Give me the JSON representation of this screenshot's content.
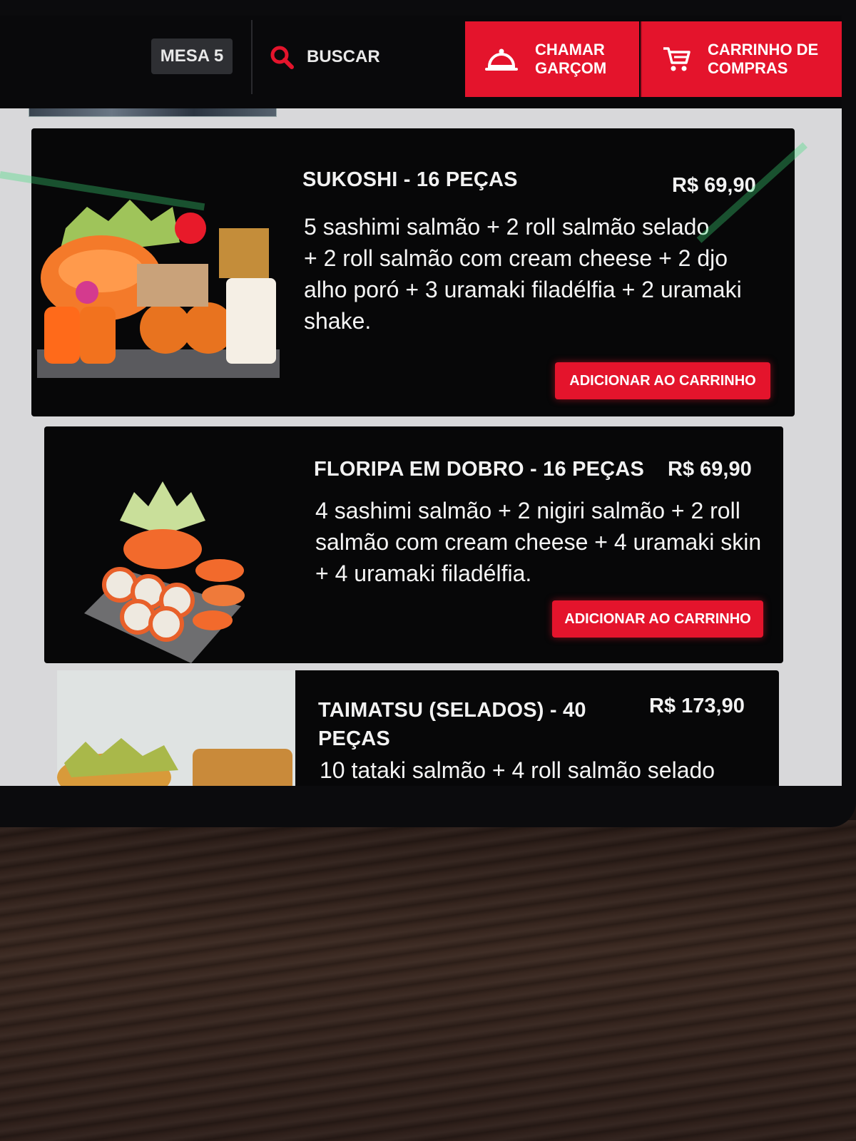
{
  "header": {
    "table_label": "MESA 5",
    "search_label": "BUSCAR",
    "waiter_button": [
      "CHAMAR",
      "GARÇOM"
    ],
    "cart_button": [
      "CARRINHO DE",
      "COMPRAS"
    ],
    "accent_color": "#e4142c",
    "icons": {
      "search": "search-icon",
      "waiter": "service-bell-icon",
      "cart": "shopping-cart-icon"
    }
  },
  "menu": {
    "items": [
      {
        "title": "SUKOSHI - 16 PEÇAS",
        "price": "R$ 69,90",
        "description": [
          "5 sashimi salmão + 2 roll salmão selado",
          "+ 2 roll salmão com cream cheese + 2 djo",
          "alho poró + 3 uramaki filadélfia + 2 uramaki",
          "shake."
        ],
        "add_label": "ADICIONAR AO CARRINHO"
      },
      {
        "title": "FLORIPA EM DOBRO - 16 PEÇAS",
        "price": "R$ 69,90",
        "description": [
          "4 sashimi salmão + 2 nigiri salmão + 2 roll",
          "salmão com cream cheese + 4 uramaki skin",
          "+ 4 uramaki filadélfia."
        ],
        "add_label": "ADICIONAR AO CARRINHO"
      },
      {
        "title": [
          "TAIMATSU (SELADOS) - 40",
          "PEÇAS"
        ],
        "price": "R$ 173,90",
        "description": [
          "10 tataki salmão + 4 roll salmão selado"
        ]
      }
    ]
  }
}
